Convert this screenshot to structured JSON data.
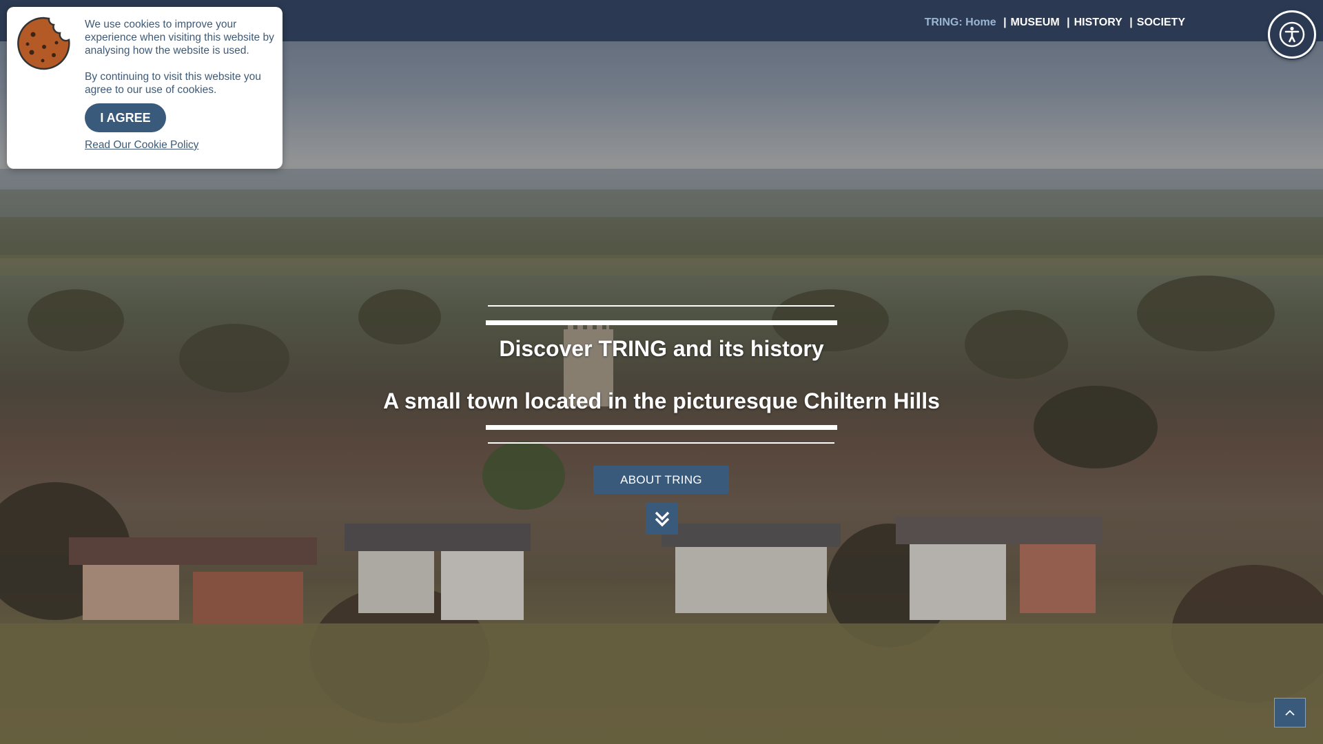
{
  "nav": {
    "brand": "TRING:",
    "home": "Home",
    "sep1": "|",
    "museum": "MUSEUM",
    "sep2": "|",
    "history": "HISTORY",
    "sep3": "|",
    "society": "SOCIETY"
  },
  "cookie": {
    "text1": "We use cookies to improve your experience when visiting this website by analysing how the website is used.",
    "text2": "By continuing to visit this website you agree to our use of cookies.",
    "agree_label": "I AGREE",
    "policy_link": "Read Our Cookie Policy"
  },
  "hero": {
    "title": "Discover TRING and its history",
    "subtitle": "A small town located in the picturesque Chiltern Hills",
    "about_button": "ABOUT TRING"
  },
  "icons": {
    "accessibility": "accessibility-icon",
    "scroll_down": "double-chevron-down-icon",
    "back_to_top": "chevron-up-icon",
    "cookie": "cookie-icon"
  },
  "colors": {
    "topbar": "#2b3a52",
    "accent": "#3a5a7c",
    "nav_highlight": "#9bb6d4",
    "cookie_text": "#3e5a76"
  }
}
